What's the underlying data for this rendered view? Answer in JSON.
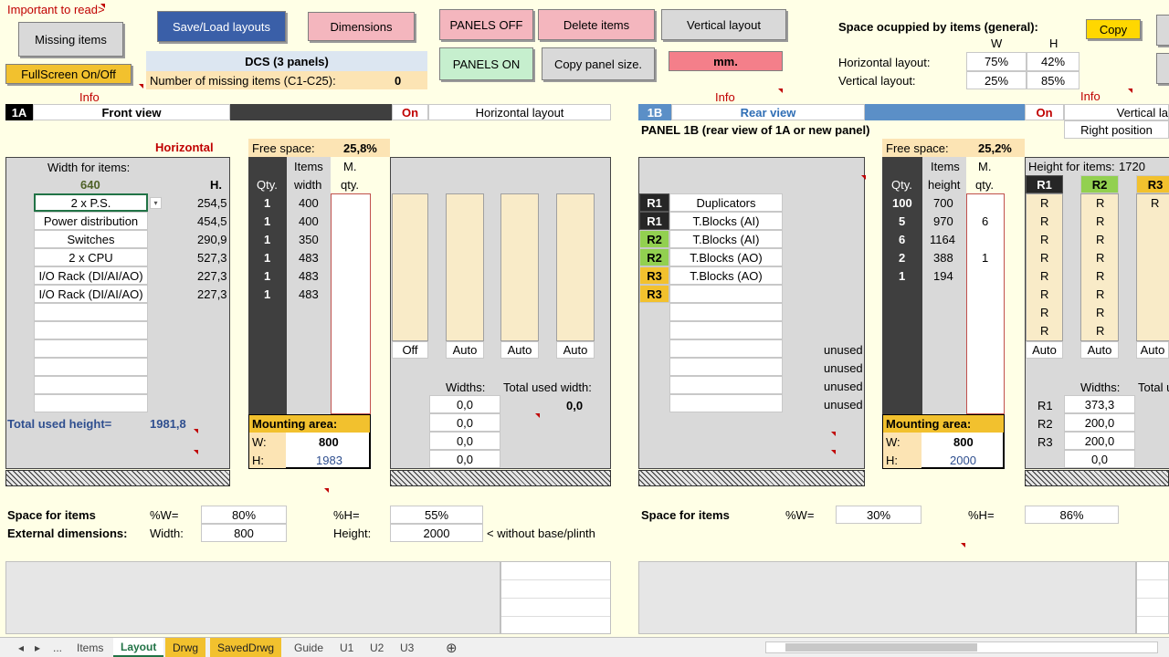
{
  "top": {
    "important": "Important to read>",
    "missing_items": "Missing items",
    "fullscreen": "FullScreen On/Off",
    "save_load": "Save/Load layouts",
    "dimensions": "Dimensions",
    "panels_off": "PANELS OFF",
    "panels_on": "PANELS ON",
    "delete_items": "Delete items",
    "copy_panel_size": "Copy panel size.",
    "vertical_layout": "Vertical layout",
    "unit": "mm.",
    "dcs": "DCS (3 panels)",
    "missing_count_label": "Number of missing items (C1-C25):",
    "missing_count": "0",
    "info": "Info",
    "space_title": "Space ocuppied by items (general):",
    "w": "W",
    "h": "H",
    "horiz_label": "Horizontal layout:",
    "vert_label": "Vertical layout:",
    "horiz_w": "75%",
    "horiz_h": "42%",
    "vert_w": "25%",
    "vert_h": "85%",
    "copy": "Copy"
  },
  "panelA": {
    "id": "1A",
    "title": "Front view",
    "on": "On",
    "layout": "Horizontal layout",
    "orientation": "Horizontal",
    "free_space_label": "Free space:",
    "free_space": "25,8%",
    "width_for_items_label": "Width for items:",
    "width_for_items": "640",
    "h_label": "H.",
    "qty_label": "Qty.",
    "items_label": "Items",
    "width_label": "width",
    "m_label": "M.",
    "mqty_label": "qty.",
    "items": [
      {
        "name": "2 x P.S.",
        "h": "254,5",
        "qty": "1",
        "w": "400"
      },
      {
        "name": "Power distribution",
        "h": "454,5",
        "qty": "1",
        "w": "400"
      },
      {
        "name": "Switches",
        "h": "290,9",
        "qty": "1",
        "w": "350"
      },
      {
        "name": "2 x CPU",
        "h": "527,3",
        "qty": "1",
        "w": "483"
      },
      {
        "name": "I/O Rack (DI/AI/AO)",
        "h": "227,3",
        "qty": "1",
        "w": "483"
      },
      {
        "name": "I/O Rack (DI/AI/AO)",
        "h": "227,3",
        "qty": "1",
        "w": "483"
      }
    ],
    "total_used_height_label": "Total used height=",
    "total_used_height": "1981,8",
    "mounting_area": "Mounting area:",
    "w_label": "W:",
    "h2_label": "H:",
    "mount_w": "800",
    "mount_h": "1983",
    "column_modes": [
      "Off",
      "Auto",
      "Auto",
      "Auto"
    ],
    "widths_label": "Widths:",
    "total_used_width_label": "Total used width:",
    "total_used_width": "0,0",
    "widths": [
      "0,0",
      "0,0",
      "0,0",
      "0,0"
    ],
    "space_for_items": "Space for items",
    "ext_dims": "External dimensions:",
    "pct_w_label": "%W=",
    "pct_w": "80%",
    "pct_h_label": "%H=",
    "pct_h": "55%",
    "width_lbl": "Width:",
    "ext_width": "800",
    "height_lbl": "Height:",
    "ext_height": "2000",
    "without_base": "< without base/plinth"
  },
  "panelB": {
    "id": "1B",
    "title": "Rear view",
    "on": "On",
    "layout": "Vertical la",
    "position": "Right position",
    "subtitle": "PANEL 1B (rear view of 1A or new panel)",
    "free_space_label": "Free space:",
    "free_space": "25,2%",
    "qty_label": "Qty.",
    "items_label": "Items",
    "height_label": "height",
    "m_label": "M.",
    "mqty_label": "qty.",
    "height_for_items_label": "Height for items:",
    "height_for_items": "1720",
    "rows": [
      {
        "r": "R1",
        "name": "Duplicators",
        "qty": "100",
        "h": "700",
        "m": ""
      },
      {
        "r": "R1",
        "name": "T.Blocks (AI)",
        "qty": "5",
        "h": "970",
        "m": "6"
      },
      {
        "r": "R2",
        "name": "T.Blocks (AI)",
        "qty": "6",
        "h": "1164",
        "m": ""
      },
      {
        "r": "R2",
        "name": "T.Blocks (AO)",
        "qty": "2",
        "h": "388",
        "m": "1"
      },
      {
        "r": "R3",
        "name": "T.Blocks (AO)",
        "qty": "1",
        "h": "194",
        "m": ""
      },
      {
        "r": "R3",
        "name": "",
        "qty": "",
        "h": "",
        "m": ""
      }
    ],
    "unused": "unused",
    "col_heads": [
      "R1",
      "R2",
      "R3"
    ],
    "r": "R",
    "modes": [
      "Auto",
      "Auto",
      "Auto"
    ],
    "widths_label": "Widths:",
    "total_label": "Total u",
    "widths": [
      {
        "r": "R1",
        "v": "373,3"
      },
      {
        "r": "R2",
        "v": "200,0"
      },
      {
        "r": "R3",
        "v": "200,0"
      },
      {
        "r": "",
        "v": "0,0"
      }
    ],
    "mounting_area": "Mounting area:",
    "w_label": "W:",
    "h2_label": "H:",
    "mount_w": "800",
    "mount_h": "2000",
    "space_for_items": "Space for items",
    "pct_w_label": "%W=",
    "pct_w": "30%",
    "pct_h_label": "%H=",
    "pct_h": "86%"
  },
  "tabs": [
    "...",
    "Items",
    "Layout",
    "Drwg",
    "SavedDrwg",
    "Guide",
    "U1",
    "U2",
    "U3"
  ],
  "colors": {
    "r1": "#262626",
    "r2": "#92d050",
    "r3": "#f2c12e",
    "accent_blue": "#5b8fc7"
  }
}
